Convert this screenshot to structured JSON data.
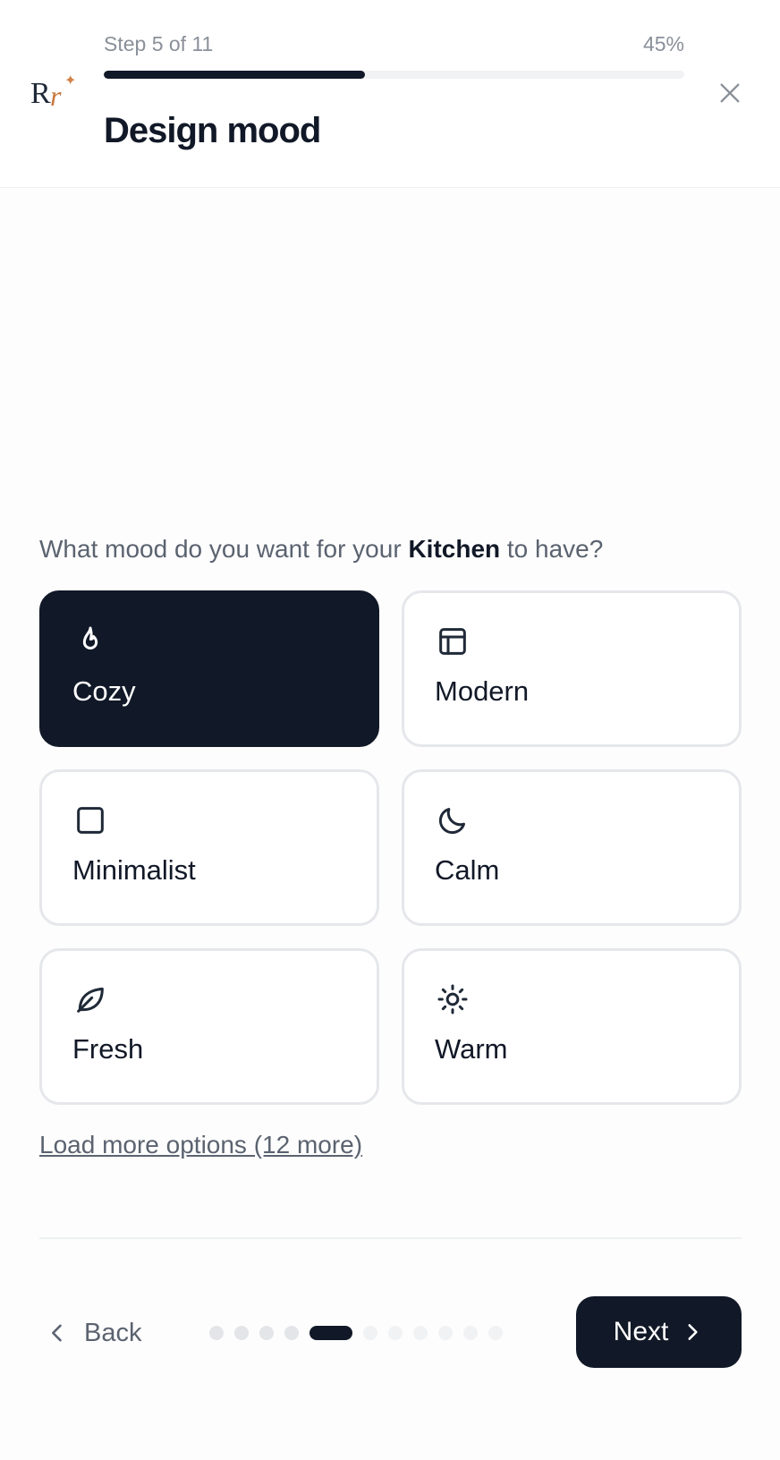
{
  "header": {
    "logo_text": "Rr",
    "step_label": "Step 5 of 11",
    "percent_label": "45%",
    "progress_fraction": 0.45,
    "title": "Design mood",
    "close_icon": "close-icon"
  },
  "question": {
    "prefix": "What mood do you want for your ",
    "room": "Kitchen",
    "suffix": " to have?"
  },
  "options": [
    {
      "label": "Cozy",
      "icon": "flame-icon",
      "selected": true
    },
    {
      "label": "Modern",
      "icon": "layout-icon",
      "selected": false
    },
    {
      "label": "Minimalist",
      "icon": "square-icon",
      "selected": false
    },
    {
      "label": "Calm",
      "icon": "moon-icon",
      "selected": false
    },
    {
      "label": "Fresh",
      "icon": "leaf-icon",
      "selected": false
    },
    {
      "label": "Warm",
      "icon": "sun-icon",
      "selected": false
    }
  ],
  "load_more_label": "Load more options (12 more)",
  "footer": {
    "back_label": "Back",
    "next_label": "Next",
    "total_steps": 11,
    "current_step": 5
  },
  "colors": {
    "primary": "#111827",
    "muted_text": "#5b6370",
    "accent_logo": "#c8773d",
    "border": "#e5e7eb"
  }
}
